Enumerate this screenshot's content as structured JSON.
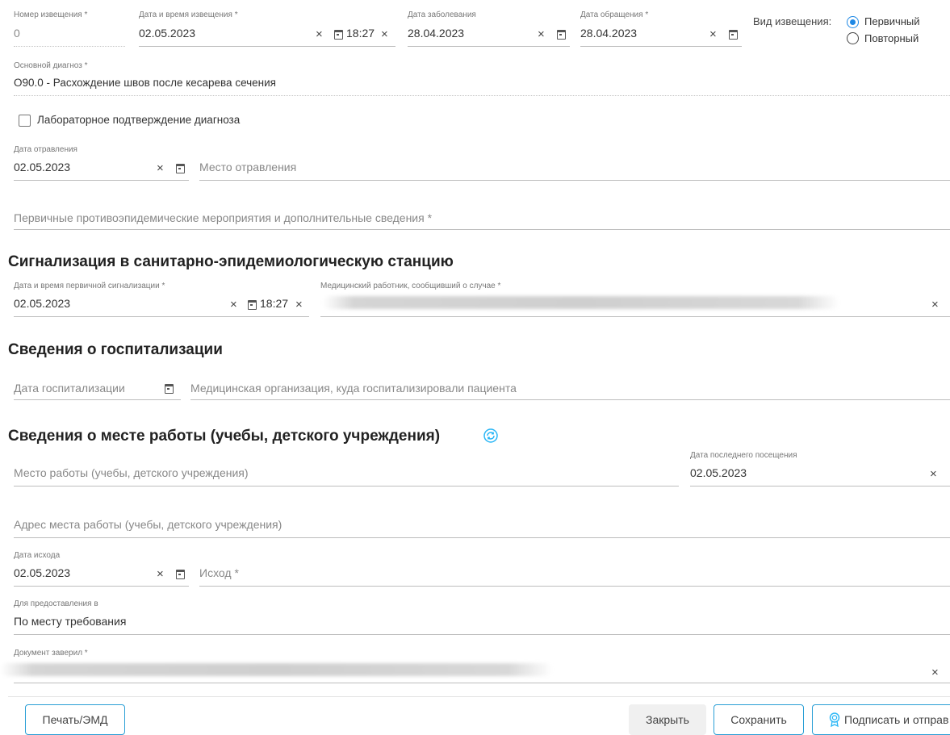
{
  "notice": {
    "number_label": "Номер извещения *",
    "number_value": "0",
    "datetime_label": "Дата и время извещения *",
    "date_value": "02.05.2023",
    "time_value": "18:27",
    "illness_date_label": "Дата заболевания",
    "illness_date_value": "28.04.2023",
    "appeal_date_label": "Дата обращения *",
    "appeal_date_value": "28.04.2023",
    "kind_label": "Вид извещения:",
    "kind_options": [
      "Первичный",
      "Повторный"
    ],
    "kind_selected": "Первичный"
  },
  "diagnosis": {
    "label": "Основной диагноз *",
    "value": "O90.0 - Расхождение швов после кесарева сечения",
    "lab_confirm_label": "Лабораторное подтверждение диагноза"
  },
  "poisoning": {
    "date_label": "Дата отравления",
    "date_value": "02.05.2023",
    "place_placeholder": "Место отравления"
  },
  "measures": {
    "placeholder": "Первичные противоэпидемические мероприятия и дополнительные сведения *"
  },
  "signal": {
    "heading": "Сигнализация в санитарно-эпидемиологическую станцию",
    "datetime_label": "Дата и время первичной сигнализации *",
    "date_value": "02.05.2023",
    "time_value": "18:27",
    "worker_label": "Медицинский работник, сообщивший о случае *"
  },
  "hospital": {
    "heading": "Сведения о госпитализации",
    "date_placeholder": "Дата госпитализации",
    "org_placeholder": "Медицинская организация, куда госпитализировали пациента"
  },
  "work": {
    "heading": "Сведения о месте работы (учебы, детского учреждения)",
    "place_placeholder": "Место работы (учебы, детского учреждения)",
    "last_visit_label": "Дата последнего посещения",
    "last_visit_value": "02.05.2023",
    "address_placeholder": "Адрес места работы (учебы, детского учреждения)"
  },
  "outcome": {
    "date_label": "Дата исхода",
    "date_value": "02.05.2023",
    "outcome_placeholder": "Исход *"
  },
  "provide": {
    "label": "Для предоставления в",
    "value": "По месту требования"
  },
  "certified": {
    "label": "Документ заверил *"
  },
  "footer": {
    "print_label": "Печать/ЭМД",
    "close_label": "Закрыть",
    "save_label": "Сохранить",
    "sign_label": "Подписать и отправ"
  },
  "colors": {
    "accent": "#1e88e5",
    "button_border": "#2a9fd6"
  }
}
